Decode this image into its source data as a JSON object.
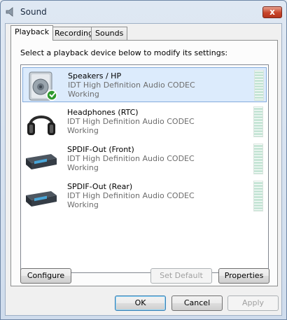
{
  "window": {
    "title": "Sound",
    "close_glyph": "x"
  },
  "tabs": [
    {
      "label": "Playback",
      "active": true
    },
    {
      "label": "Recording",
      "active": false
    },
    {
      "label": "Sounds",
      "active": false
    }
  ],
  "instructions": "Select a playback device below to modify its settings:",
  "devices": [
    {
      "name": "Speakers / HP",
      "description": "IDT High Definition Audio CODEC",
      "status": "Working",
      "icon": "speaker-icon",
      "selected": true,
      "default": true
    },
    {
      "name": "Headphones (RTC)",
      "description": "IDT High Definition Audio CODEC",
      "status": "Working",
      "icon": "headphones-icon",
      "selected": false,
      "default": false
    },
    {
      "name": "SPDIF-Out (Front)",
      "description": "IDT High Definition Audio CODEC",
      "status": "Working",
      "icon": "spdif-device-icon",
      "selected": false,
      "default": false
    },
    {
      "name": "SPDIF-Out (Rear)",
      "description": "IDT High Definition Audio CODEC",
      "status": "Working",
      "icon": "spdif-device-icon",
      "selected": false,
      "default": false
    }
  ],
  "panel_buttons": {
    "configure": "Configure",
    "set_default": "Set Default",
    "properties": "Properties"
  },
  "dialog_buttons": {
    "ok": "OK",
    "cancel": "Cancel",
    "apply": "Apply"
  },
  "colors": {
    "selection_bg": "#dcebfc",
    "selection_border": "#84acdd",
    "meter": "#c6e5d6",
    "check": "#2e9a2e"
  }
}
